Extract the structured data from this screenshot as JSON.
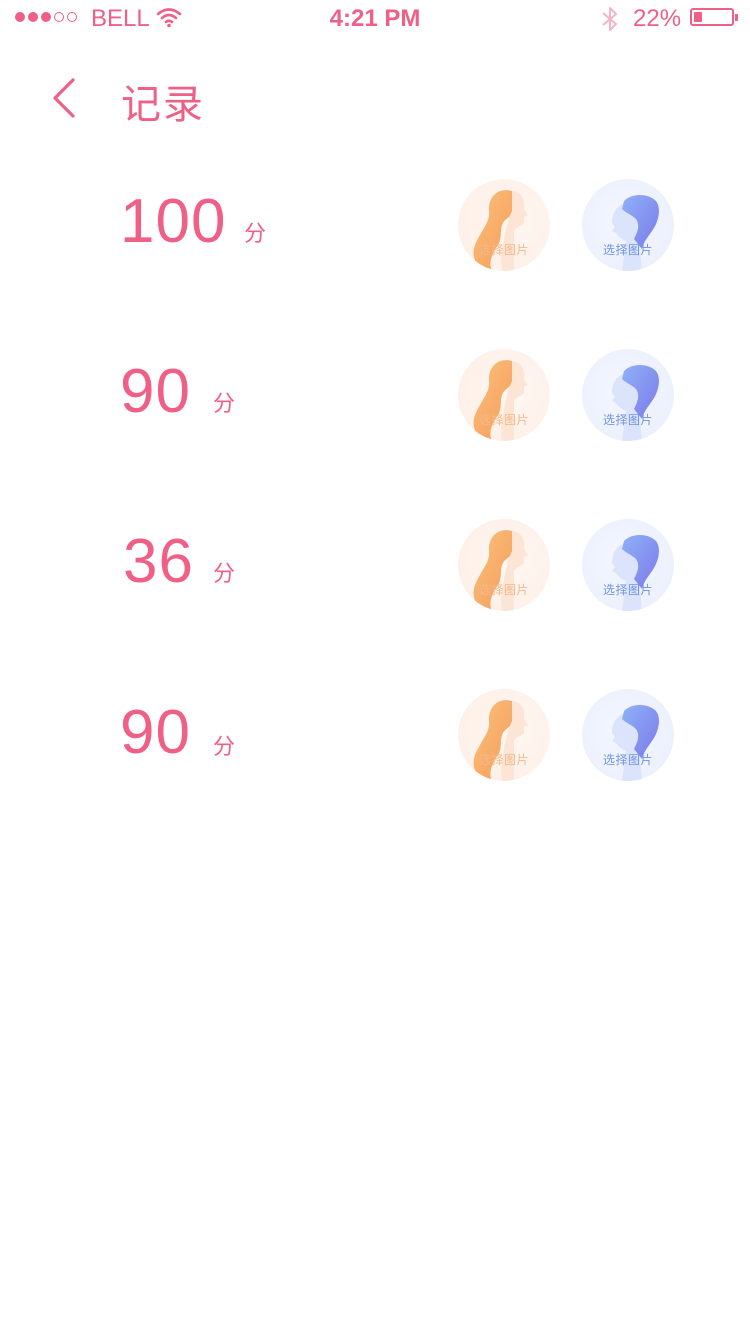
{
  "status_bar": {
    "carrier": "BELL",
    "time": "4:21 PM",
    "battery_percent": "22%",
    "battery_level": 0.22,
    "signal_bars_filled": 3,
    "signal_bars_total": 5,
    "icons": [
      "signal-dots-icon",
      "wifi-icon",
      "bluetooth-icon",
      "battery-icon"
    ]
  },
  "nav": {
    "back_icon": "chevron-left-icon",
    "title": "记录"
  },
  "records": [
    {
      "score": "100",
      "unit": "分",
      "female_avatar_label": "选择图片",
      "male_avatar_label": "选择图片"
    },
    {
      "score": "90",
      "unit": "分",
      "female_avatar_label": "选择图片",
      "male_avatar_label": "选择图片"
    },
    {
      "score": "36",
      "unit": "分",
      "female_avatar_label": "选择图片",
      "male_avatar_label": "选择图片"
    },
    {
      "score": "90",
      "unit": "分",
      "female_avatar_label": "选择图片",
      "male_avatar_label": "选择图片"
    }
  ],
  "colors": {
    "accent": "#ef5f86",
    "female_avatar": "#f7a35c",
    "male_avatar": "#7b8ff0",
    "background": "#ffffff"
  }
}
